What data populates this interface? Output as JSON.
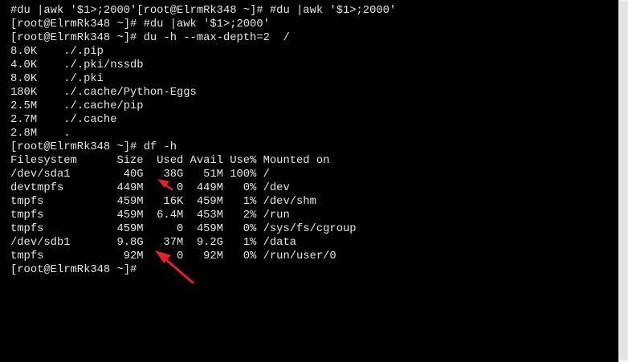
{
  "terminal": {
    "lines": [
      "#du |awk '$1>;2000'[root@ElrmRk348 ~]# #du |awk '$1>;2000'",
      "[root@ElrmRk348 ~]# #du |awk '$1>;2000'",
      "[root@ElrmRk348 ~]# du -h --max-depth=2  /",
      "8.0K    ./.pip",
      "4.0K    ./.pki/nssdb",
      "8.0K    ./.pki",
      "180K    ./.cache/Python-Eggs",
      "2.5M    ./.cache/pip",
      "2.7M    ./.cache",
      "2.8M    .",
      "[root@ElrmRk348 ~]# df -h",
      "Filesystem      Size  Used Avail Use% Mounted on",
      "/dev/sda1        40G   38G   51M 100% /",
      "devtmpfs        449M     0  449M   0% /dev",
      "tmpfs           459M   16K  459M   1% /dev/shm",
      "tmpfs           459M  6.4M  453M   2% /run",
      "tmpfs           459M     0  459M   0% /sys/fs/cgroup",
      "/dev/sdb1       9.8G   37M  9.2G   1% /data",
      "tmpfs            92M     0   92M   0% /run/user/0",
      "[root@ElrmRk348 ~]#"
    ]
  },
  "colors": {
    "background": "#000000",
    "foreground": "#e6e6e6",
    "annotation_arrow": "#e8202a"
  }
}
